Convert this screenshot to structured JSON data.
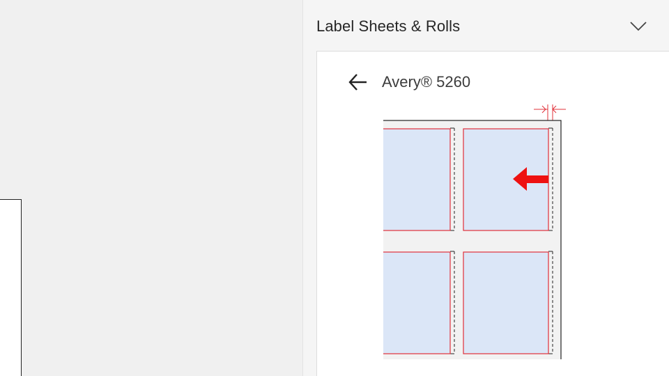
{
  "panel": {
    "title": "Label Sheets & Rolls",
    "collapse_icon": "chevron-down-icon"
  },
  "product": {
    "back_icon": "arrow-left-icon",
    "name": "Avery® 5260"
  },
  "preview": {
    "label_count": 4,
    "label_fill_color": "#dbe6f7",
    "label_outline_color": "#e0303a",
    "indicator_icon": "arrow-left-icon",
    "indicator_color": "#ee1111",
    "dimension_marker": "right-margin"
  }
}
